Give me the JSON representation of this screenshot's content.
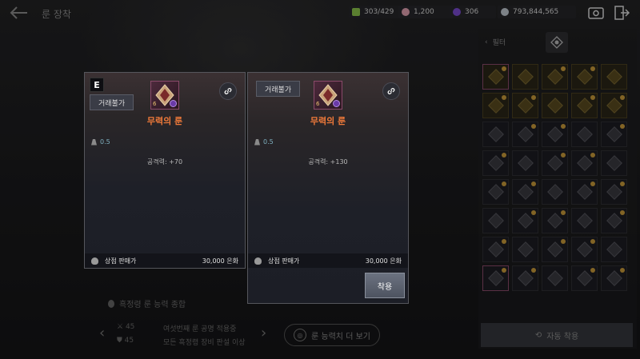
{
  "header": {
    "title": "룬 장착",
    "resources": [
      {
        "icon": "leaf-icon",
        "value": "303/429",
        "color": "#8bc34a"
      },
      {
        "icon": "pearl-icon",
        "value": "1,200",
        "color": "#e0a0b0"
      },
      {
        "icon": "purple-gem-icon",
        "value": "306",
        "color": "#7a4ad0"
      },
      {
        "icon": "silver-coin-icon",
        "value": "793,844,565",
        "color": "#c0c8d0"
      }
    ]
  },
  "left_card": {
    "grade": "E",
    "trade": "거래불가",
    "name": "무력의 룬",
    "level": "6",
    "weight": "0.5",
    "stat": "공격력: +70",
    "price_label": "상점 판매가",
    "price": "30,000 은화"
  },
  "right_card": {
    "trade": "거래불가",
    "name": "무력의 룬",
    "level": "6",
    "weight": "0.5",
    "stat": "공격력: +130",
    "price_label": "상점 판매가",
    "price": "30,000 은화",
    "equip_label": "착용"
  },
  "background": {
    "summary_title": "흑정령 룬 능력 종합",
    "stat1_val": "45",
    "stat2_val": "45",
    "line1": "여섯번째 룬 공명 적용중",
    "line2": "모든 흑정령 장비 판설 이상",
    "more_label": "룬 능력치 더 보기"
  },
  "right_panel": {
    "filter_label": "필터",
    "auto_equip_label": "자동 착용"
  },
  "colors": {
    "rune_name": "#f07a3a",
    "weight": "#7fb0c0"
  }
}
